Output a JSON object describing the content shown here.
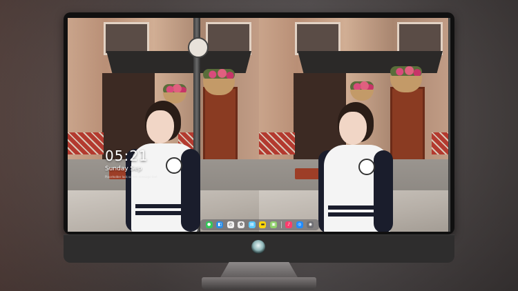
{
  "lock_screen": {
    "time": "05:21",
    "date": "Sunday Sep",
    "subtitle": "Placeholder lock screen message text"
  },
  "dock": {
    "apps": [
      {
        "name": "messages-icon",
        "glyph": "●",
        "color": "#34c759"
      },
      {
        "name": "finder-icon",
        "glyph": "◧",
        "color": "#2b8ce6"
      },
      {
        "name": "clock-app-icon",
        "glyph": "◴",
        "color": "#f2f2f2"
      },
      {
        "name": "photos-icon",
        "glyph": "✿",
        "color": "#e9e9e9"
      },
      {
        "name": "appstore-folder-icon",
        "glyph": "▤",
        "color": "#5ac8fa"
      },
      {
        "name": "notes-icon",
        "glyph": "▬",
        "color": "#ffd60a"
      },
      {
        "name": "preview-icon",
        "glyph": "▣",
        "color": "#8fd16a"
      },
      {
        "name": "music-icon",
        "glyph": "♪",
        "color": "#fc3c6d"
      },
      {
        "name": "safari-icon",
        "glyph": "◎",
        "color": "#1f8bff"
      },
      {
        "name": "camera-icon",
        "glyph": "◉",
        "color": "#6e6e73"
      }
    ]
  },
  "colors": {
    "bezel": "#101010",
    "chin": "#2e2d2d",
    "accent_teal": "#8fb6b8"
  }
}
